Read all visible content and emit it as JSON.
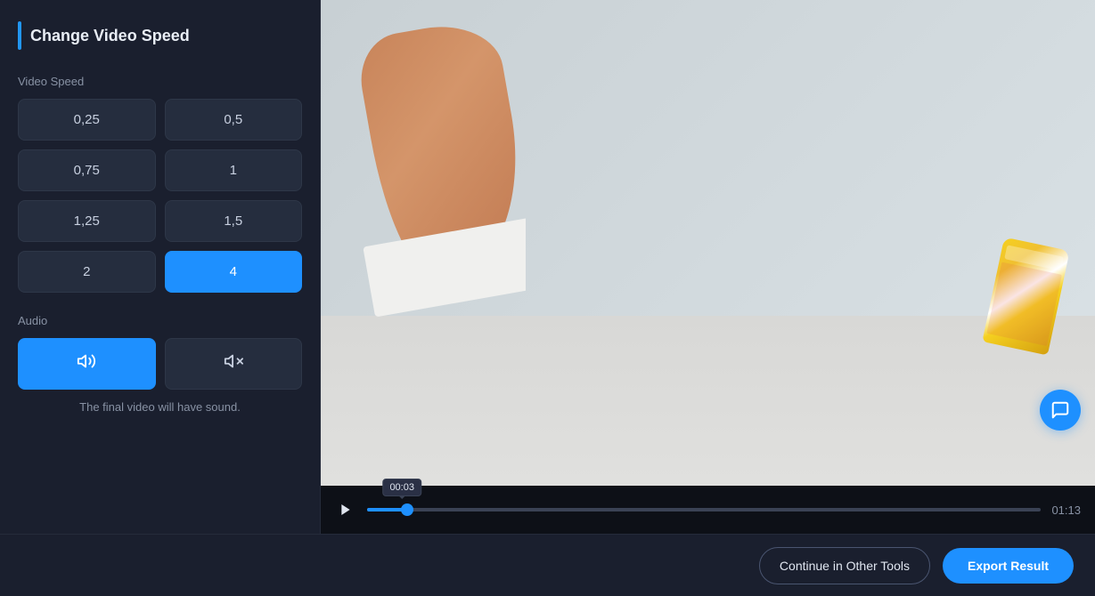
{
  "sidebar": {
    "title": "Change Video Speed",
    "speed_section_label": "Video Speed",
    "speeds": [
      {
        "value": "0,25",
        "id": "speed-025",
        "active": false
      },
      {
        "value": "0,5",
        "id": "speed-05",
        "active": false
      },
      {
        "value": "0,75",
        "id": "speed-075",
        "active": false
      },
      {
        "value": "1",
        "id": "speed-1",
        "active": false
      },
      {
        "value": "1,25",
        "id": "speed-125",
        "active": false
      },
      {
        "value": "1,5",
        "id": "speed-15",
        "active": false
      },
      {
        "value": "2",
        "id": "speed-2",
        "active": false
      },
      {
        "value": "4",
        "id": "speed-4",
        "active": true
      }
    ],
    "audio_section_label": "Audio",
    "audio_note": "The final video will have sound.",
    "audio_options": [
      {
        "id": "audio-on",
        "active": true
      },
      {
        "id": "audio-off",
        "active": false
      }
    ]
  },
  "player": {
    "current_time": "00:03",
    "total_time": "01:13",
    "progress_percent": 6
  },
  "bottom_bar": {
    "continue_label": "Continue in Other Tools",
    "export_label": "Export Result"
  },
  "colors": {
    "accent": "#1e90ff",
    "background": "#1a1f2e",
    "surface": "#252d3e"
  }
}
